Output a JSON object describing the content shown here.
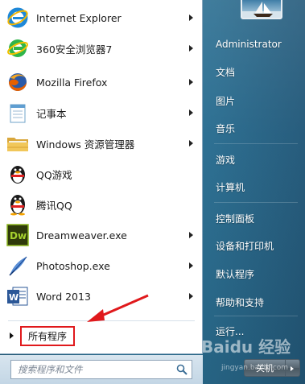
{
  "programs": [
    {
      "label": "Internet Explorer",
      "icon": "ie-icon",
      "has_arrow": true
    },
    {
      "label": "360安全浏览器7",
      "icon": "360-browser-icon",
      "has_arrow": true
    },
    {
      "label": "Mozilla Firefox",
      "icon": "firefox-icon",
      "has_arrow": true
    },
    {
      "label": "记事本",
      "icon": "notepad-icon",
      "has_arrow": true
    },
    {
      "label": "Windows 资源管理器",
      "icon": "explorer-folder-icon",
      "has_arrow": true
    },
    {
      "label": "QQ游戏",
      "icon": "qq-game-icon",
      "has_arrow": false
    },
    {
      "label": "腾讯QQ",
      "icon": "qq-penguin-icon",
      "has_arrow": false
    },
    {
      "label": "Dreamweaver.exe",
      "icon": "dreamweaver-icon",
      "has_arrow": true
    },
    {
      "label": "Photoshop.exe",
      "icon": "photoshop-feather-icon",
      "has_arrow": true
    },
    {
      "label": "Word 2013",
      "icon": "word-icon",
      "has_arrow": true
    }
  ],
  "all_programs": {
    "label": "所有程序"
  },
  "search": {
    "placeholder": "搜索程序和文件"
  },
  "right_items": [
    {
      "label": "Administrator"
    },
    {
      "label": "文档"
    },
    {
      "label": "图片"
    },
    {
      "label": "音乐"
    },
    {
      "label": "游戏"
    },
    {
      "label": "计算机"
    },
    {
      "label": "控制面板"
    },
    {
      "label": "设备和打印机"
    },
    {
      "label": "默认程序"
    },
    {
      "label": "帮助和支持"
    },
    {
      "label": "运行..."
    }
  ],
  "shutdown": {
    "label": "关机"
  },
  "watermark": {
    "text": "Baidu 经验",
    "sub": "jingyan.baidu.com"
  },
  "colors": {
    "highlight_border": "#e0191c",
    "annotation_arrow": "#e0191c"
  }
}
